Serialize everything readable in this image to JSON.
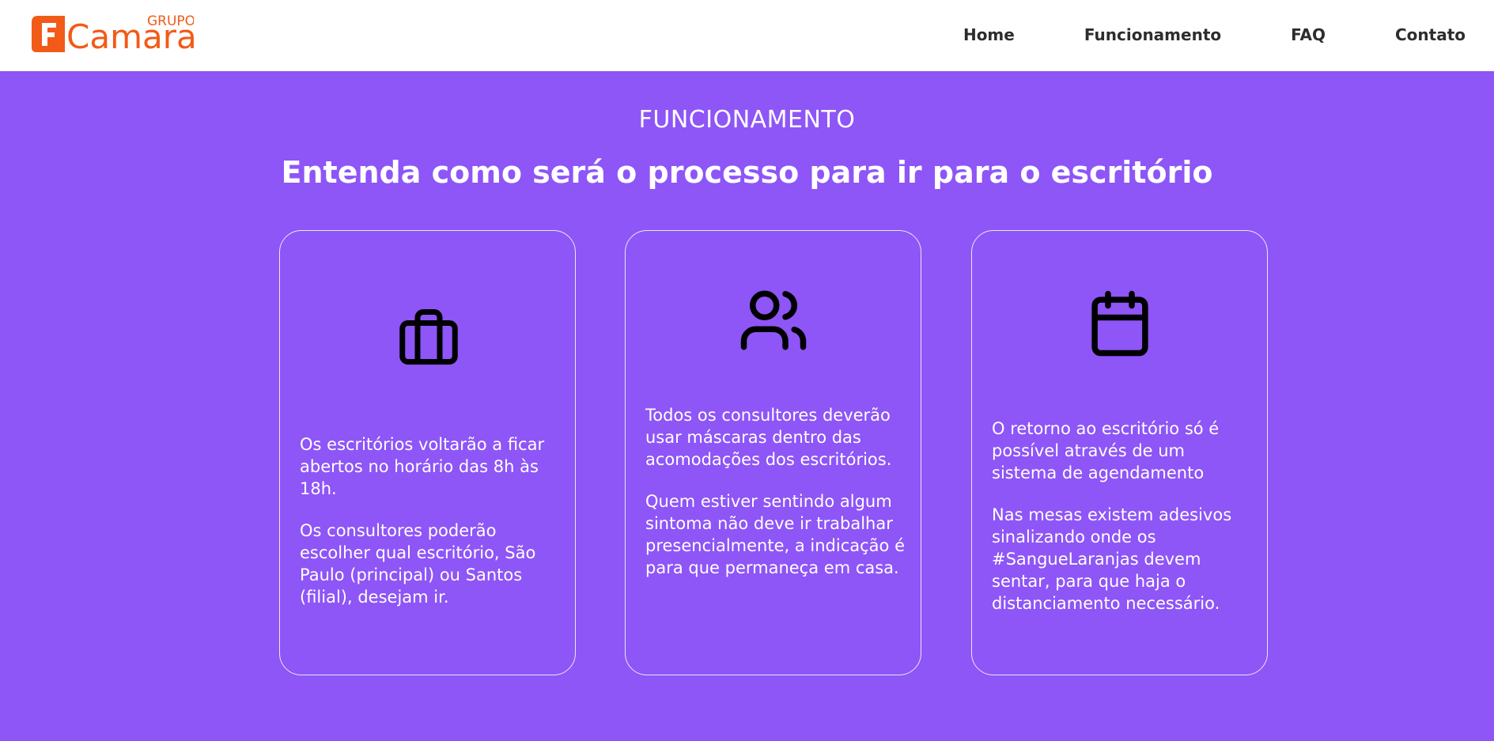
{
  "header": {
    "logo": {
      "prefix": "GRUPO",
      "name": "Camara",
      "mark_letter": "F",
      "color": "#f25a17"
    },
    "nav": [
      {
        "label": "Home"
      },
      {
        "label": "Funcionamento"
      },
      {
        "label": "FAQ"
      },
      {
        "label": "Contato"
      }
    ]
  },
  "section": {
    "label": "FUNCIONAMENTO",
    "heading": "Entenda como será o processo para ir para o escritório",
    "background_color": "#8e55f7",
    "cards": [
      {
        "icon": "briefcase-icon",
        "paragraphs": [
          "Os escritórios voltarão a ficar abertos no horário das 8h às 18h.",
          "Os consultores poderão escolher qual escritório, São Paulo (principal) ou Santos (filial), desejam ir."
        ]
      },
      {
        "icon": "users-icon",
        "paragraphs": [
          "Todos os consultores deverão usar máscaras dentro das acomodações dos escritórios.",
          "Quem estiver sentindo algum sintoma não deve ir trabalhar presencialmente, a indicação é para que permaneça em casa."
        ]
      },
      {
        "icon": "calendar-icon",
        "paragraphs": [
          "O retorno ao escritório só é possível através de um sistema de agendamento",
          "Nas mesas existem adesivos sinalizando onde os #SangueLaranjas devem sentar, para que haja o distanciamento necessário."
        ]
      }
    ]
  }
}
